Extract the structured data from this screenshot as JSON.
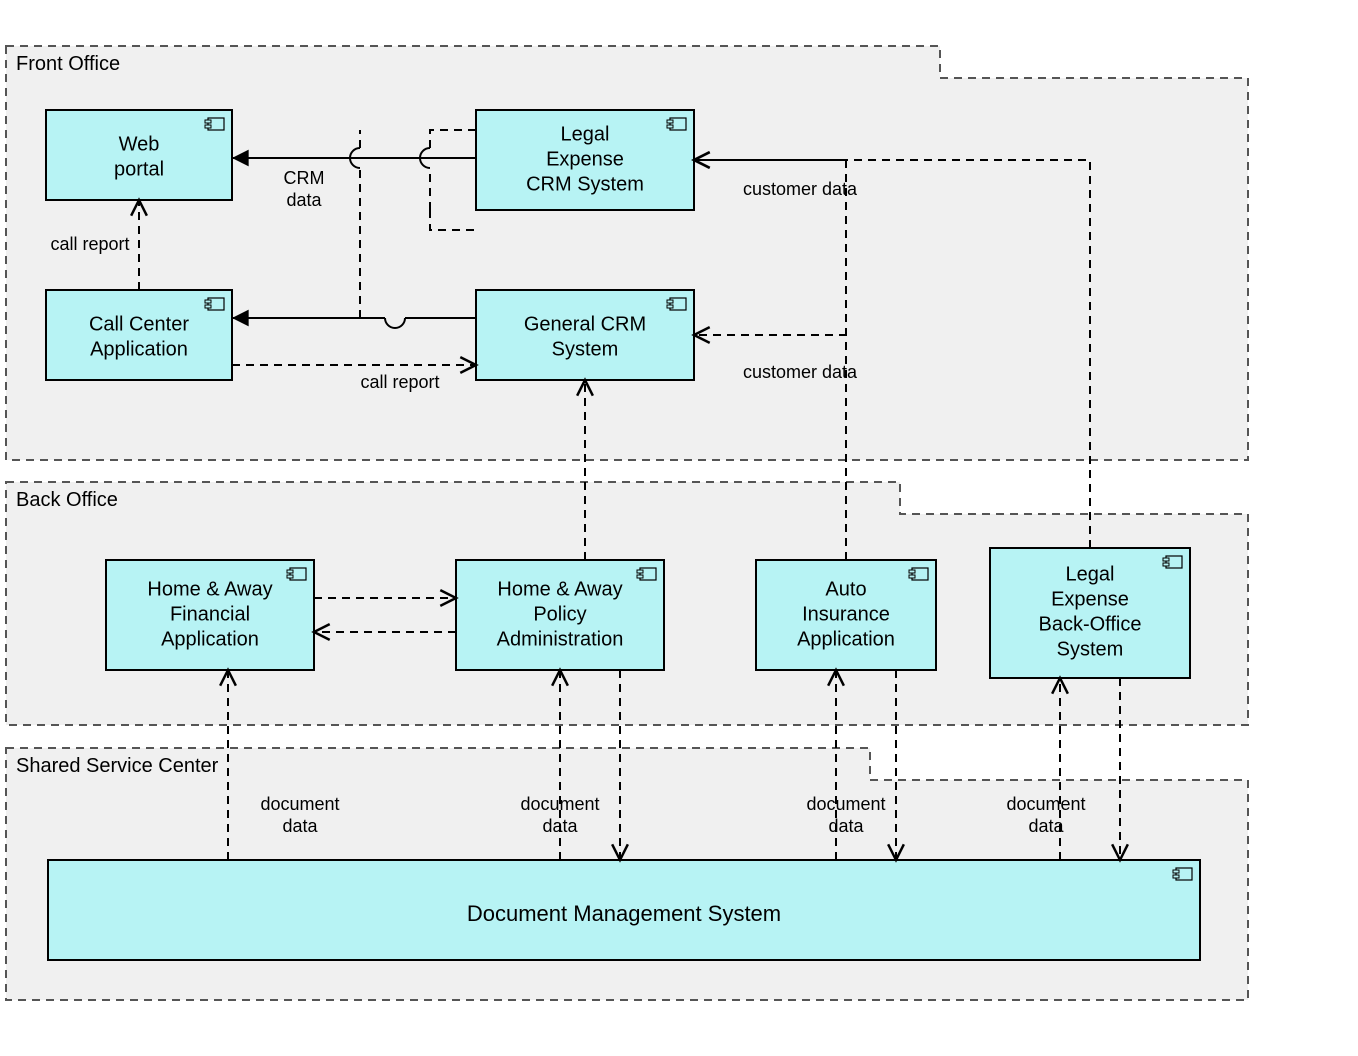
{
  "groups": {
    "front_office": {
      "title": "Front Office"
    },
    "back_office": {
      "title": "Back Office"
    },
    "shared_service_center": {
      "title": "Shared Service Center"
    }
  },
  "components": {
    "web_portal": {
      "line1": "Web",
      "line2": "portal"
    },
    "legal_crm": {
      "line1": "Legal",
      "line2": "Expense",
      "line3": "CRM System"
    },
    "call_center": {
      "line1": "Call Center",
      "line2": "Application"
    },
    "general_crm": {
      "line1": "General CRM",
      "line2": "System"
    },
    "home_away_fin": {
      "line1": "Home & Away",
      "line2": "Financial",
      "line3": "Application"
    },
    "home_away_policy": {
      "line1": "Home & Away",
      "line2": "Policy",
      "line3": "Administration"
    },
    "auto_insurance": {
      "line1": "Auto",
      "line2": "Insurance",
      "line3": "Application"
    },
    "legal_backoffice": {
      "line1": "Legal",
      "line2": "Expense",
      "line3": "Back-Office",
      "line4": "System"
    },
    "doc_mgmt": {
      "line1": "Document Management System"
    }
  },
  "edge_labels": {
    "crm_data": {
      "line1": "CRM",
      "line2": "data"
    },
    "call_report_top": "call report",
    "call_report_bottom": "call report",
    "customer_data_1": "customer data",
    "customer_data_2": "customer data",
    "doc_data_1": {
      "line1": "document",
      "line2": "data"
    },
    "doc_data_2": {
      "line1": "document",
      "line2": "data"
    },
    "doc_data_3": {
      "line1": "document",
      "line2": "data"
    },
    "doc_data_4": {
      "line1": "document",
      "line2": "data"
    }
  }
}
